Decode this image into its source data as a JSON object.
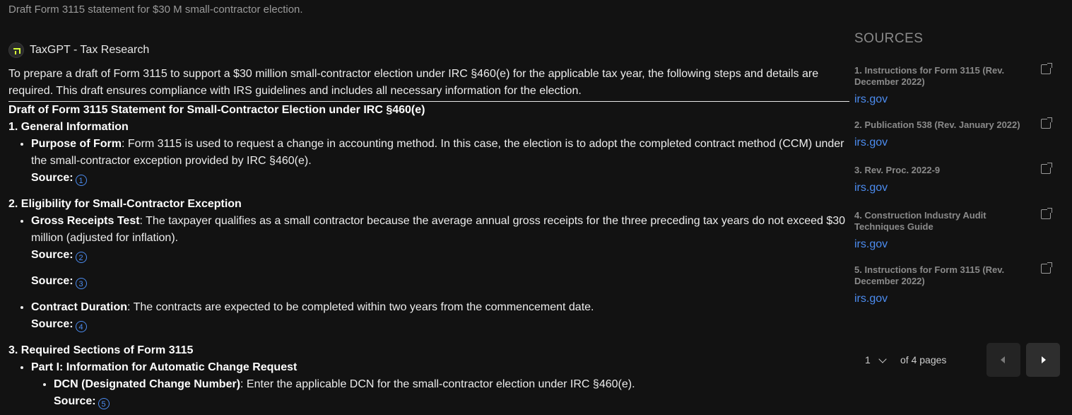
{
  "query": "Draft Form 3115 statement for $30 M small-contractor election.",
  "brand": {
    "name": "TaxGPT - Tax Research",
    "accent": "#d7ff3a"
  },
  "answer": {
    "intro": "To prepare a draft of Form 3115 to support a $30 million small-contractor election under IRC §460(e) for the applicable tax year, the following steps and details are required. This draft ensures compliance with IRS guidelines and includes all necessary information for the election.",
    "title": "Draft of Form 3115 Statement for Small-Contractor Election under IRC §460(e)",
    "source_label": "Source",
    "sections": [
      {
        "heading": "1. General Information",
        "items": [
          {
            "term": "Purpose of Form",
            "text": ": Form 3115 is used to request a change in accounting method. In this case, the election is to adopt the completed contract method (CCM) under the small-contractor exception provided by IRC §460(e).",
            "source": "1"
          }
        ]
      },
      {
        "heading": "2. Eligibility for Small-Contractor Exception",
        "items": [
          {
            "term": "Gross Receipts Test",
            "text": ": The taxpayer qualifies as a small contractor because the average annual gross receipts for the three preceding tax years do not exceed $30 million (adjusted for inflation).",
            "source": "2",
            "extra_source": "3"
          },
          {
            "term": "Contract Duration",
            "text": ": The contracts are expected to be completed within two years from the commencement date.",
            "source": "4"
          }
        ]
      },
      {
        "heading": "3. Required Sections of Form 3115",
        "items": [
          {
            "term": "Part I: Information for Automatic Change Request"
          }
        ],
        "subitems": [
          {
            "term": "DCN (Designated Change Number)",
            "text": ": Enter the applicable DCN for the small-contractor election under IRC §460(e).",
            "source": "5"
          }
        ]
      }
    ]
  },
  "sidebar": {
    "title": "SOURCES",
    "sources": [
      {
        "title": "1. Instructions for Form 3115 (Rev. December 2022)",
        "link": "irs.gov"
      },
      {
        "title": "2. Publication 538 (Rev. January 2022)",
        "link": "irs.gov"
      },
      {
        "title": "3. Rev. Proc. 2022-9",
        "link": "irs.gov"
      },
      {
        "title": "4. Construction Industry Audit Techniques Guide",
        "link": "irs.gov"
      },
      {
        "title": "5. Instructions for Form 3115 (Rev. December 2022)",
        "link": "irs.gov"
      }
    ]
  },
  "pager": {
    "current": "1",
    "of_text": "of 4 pages"
  },
  "colors": {
    "background": "#121212",
    "link": "#4c8cf0",
    "muted": "#8a8a8a"
  }
}
